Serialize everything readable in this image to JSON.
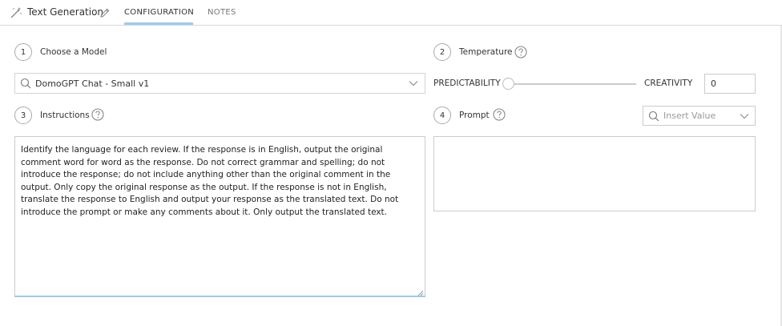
{
  "header": {
    "title": "Text Generation",
    "tabs": [
      {
        "label": "CONFIGURATION",
        "active": true
      },
      {
        "label": "NOTES",
        "active": false
      }
    ]
  },
  "model": {
    "step": "1",
    "label": "Choose a Model",
    "selected": "DomoGPT Chat - Small v1"
  },
  "temperature": {
    "step": "2",
    "label": "Temperature",
    "low_label": "PREDICTABILITY",
    "high_label": "CREATIVITY",
    "value": "0"
  },
  "instructions": {
    "step": "3",
    "label": "Instructions",
    "text": "Identify the language for each review. If the response is in English, output the original\ncomment word for word as the response. Do not correct grammar and spelling; do not\nintroduce the response; do not include anything other than the original comment in the\noutput. Only copy the original response as the output. If the response is not in English,\ntranslate the response to English and output your response as the translated text. Do not\nintroduce the prompt or make any comments about it. Only output the translated text."
  },
  "prompt": {
    "step": "4",
    "label": "Prompt",
    "insert_placeholder": "Insert Value",
    "text": ""
  },
  "colors": {
    "accent": "#99ccee",
    "border": "#cccccc",
    "text": "#333333"
  },
  "icons": [
    "magic-wand-icon",
    "pencil-icon",
    "help-icon",
    "search-icon",
    "chevron-down-icon",
    "resize-grip-icon"
  ]
}
